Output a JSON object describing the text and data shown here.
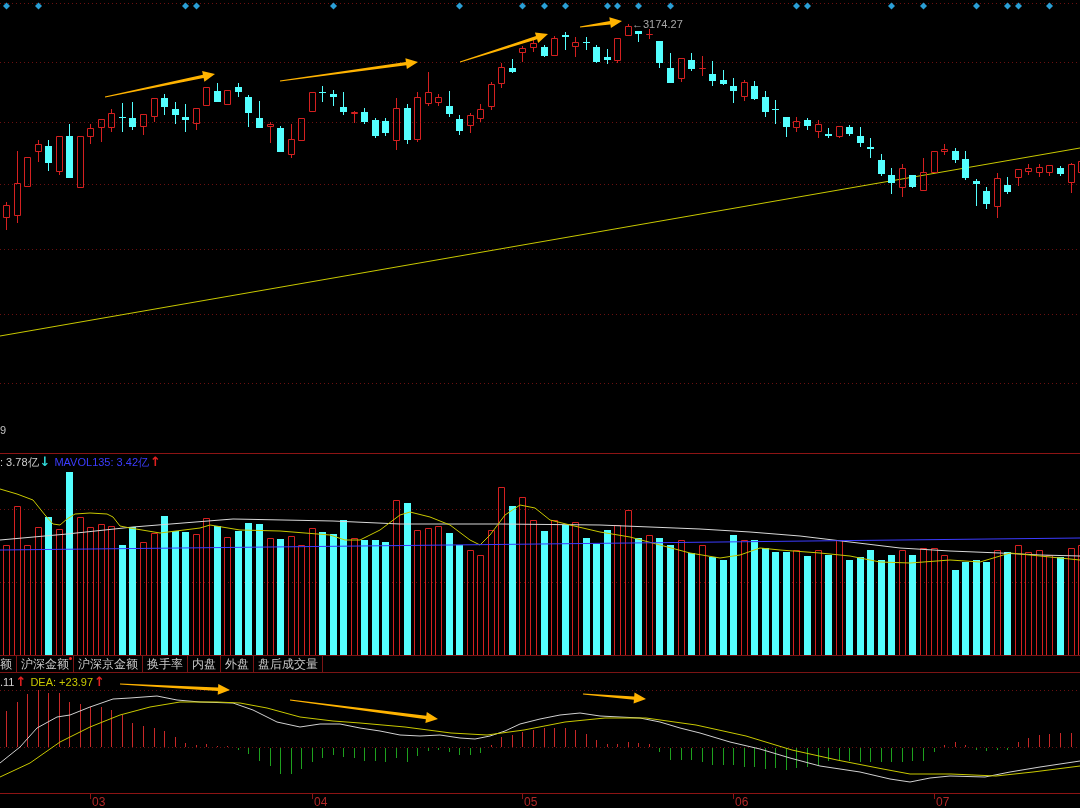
{
  "price_chart": {
    "high_label": "←3174.27",
    "edge_label": "9"
  },
  "volume_panel": {
    "legend": [
      {
        "kind": "value",
        "text": ": 3.78亿",
        "color": "#d0d0d0"
      },
      {
        "kind": "arrow",
        "text": "↓",
        "color": "#30d8d8"
      },
      {
        "kind": "value",
        "text": "MAVOL135: 3.42亿",
        "color": "#3c3cff"
      },
      {
        "kind": "arrow",
        "text": "↑",
        "color": "#e02020"
      }
    ]
  },
  "indicator_tabs": [
    {
      "label": "额",
      "selected": false,
      "notification_dot": false
    },
    {
      "label": "沪深金额",
      "selected": false,
      "notification_dot": true
    },
    {
      "label": "沪深京金额",
      "selected": false,
      "notification_dot": false
    },
    {
      "label": "换手率",
      "selected": false,
      "notification_dot": false
    },
    {
      "label": "内盘",
      "selected": false,
      "notification_dot": false
    },
    {
      "label": "外盘",
      "selected": false,
      "notification_dot": false
    },
    {
      "label": "盘后成交量",
      "selected": false,
      "notification_dot": false
    }
  ],
  "macd_panel": {
    "legend": [
      {
        "kind": "value",
        "text": ".11",
        "color": "#d0d0d0"
      },
      {
        "kind": "arrow",
        "text": "↑",
        "color": "#e02020"
      },
      {
        "kind": "value",
        "text": "DEA: +23.97",
        "color": "#c8c800"
      },
      {
        "kind": "arrow",
        "text": "↑",
        "color": "#e02020"
      }
    ]
  },
  "x_axis": {
    "labels": [
      "03",
      "04",
      "05",
      "06",
      "07"
    ]
  }
}
